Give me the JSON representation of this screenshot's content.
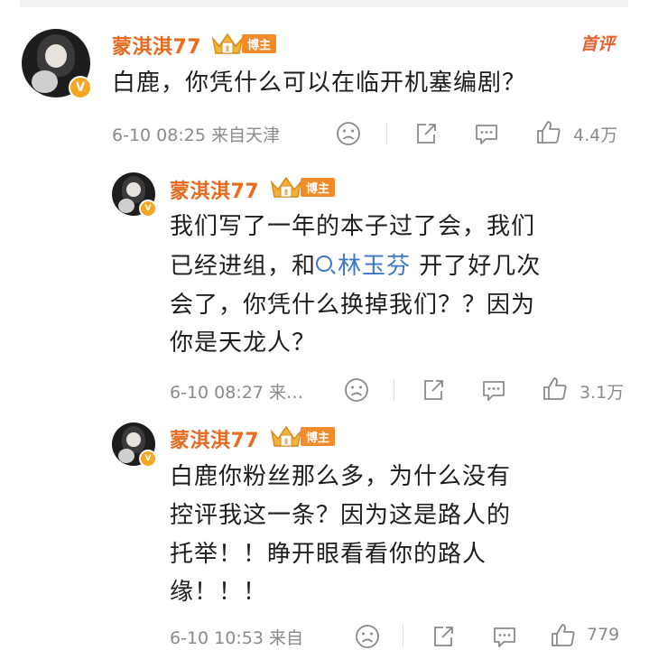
{
  "colors": {
    "username": "#e86b1f",
    "badge": "#f48b2a",
    "link": "#3a78c9",
    "meta": "#8a8a8a"
  },
  "main_comment": {
    "username": "蒙淇淇77",
    "badge": "博主",
    "first_comment_tag": "首评",
    "text": "白鹿，你凭什么可以在临开机塞编剧？",
    "time_source": "6-10 08:25  来自天津",
    "like_count": "4.4万"
  },
  "replies": [
    {
      "username": "蒙淇淇77",
      "badge": "博主",
      "lines": [
        "我们写了一年的本子过了会，我们",
        "已经进组，和",
        "林玉芬",
        " 开了好几次",
        "会了，你凭什么换掉我们？？因为",
        "你是天龙人？"
      ],
      "time_source": "6-10 08:27  来…",
      "like_count": "3.1万"
    },
    {
      "username": "蒙淇淇77",
      "badge": "博主",
      "lines": [
        "白鹿你粉丝那么多，为什么没有",
        "控评我这一条？因为这是路人的",
        "托举！！睁开眼看看你的路人",
        "缘！！！"
      ],
      "time_source": "6-10 10:53  来自",
      "like_count": "779"
    }
  ],
  "icons": [
    "sad-face-icon",
    "share-icon",
    "comment-icon",
    "like-icon",
    "verified-v-icon",
    "crown-icon",
    "search-icon"
  ]
}
